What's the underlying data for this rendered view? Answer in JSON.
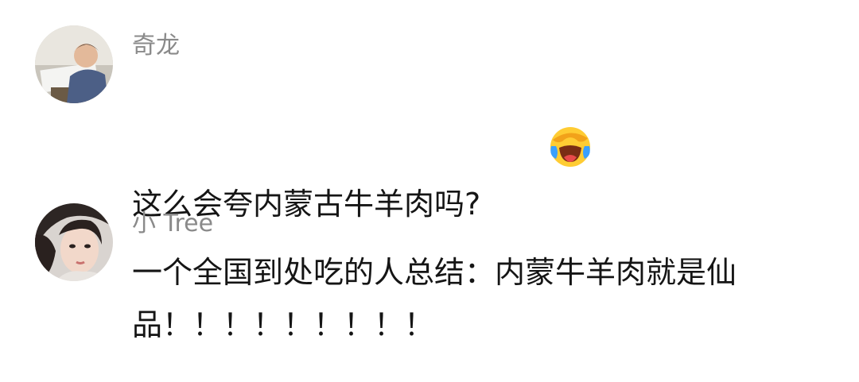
{
  "comments": [
    {
      "username": "奇龙",
      "text": "这么会夸内蒙古牛羊肉吗?",
      "emoji": "laughing-crying-emoji"
    },
    {
      "username": "小 Tree",
      "text": "一个全国到处吃的人总结：内蒙牛羊肉就是仙品！！！！！！！！！"
    }
  ]
}
